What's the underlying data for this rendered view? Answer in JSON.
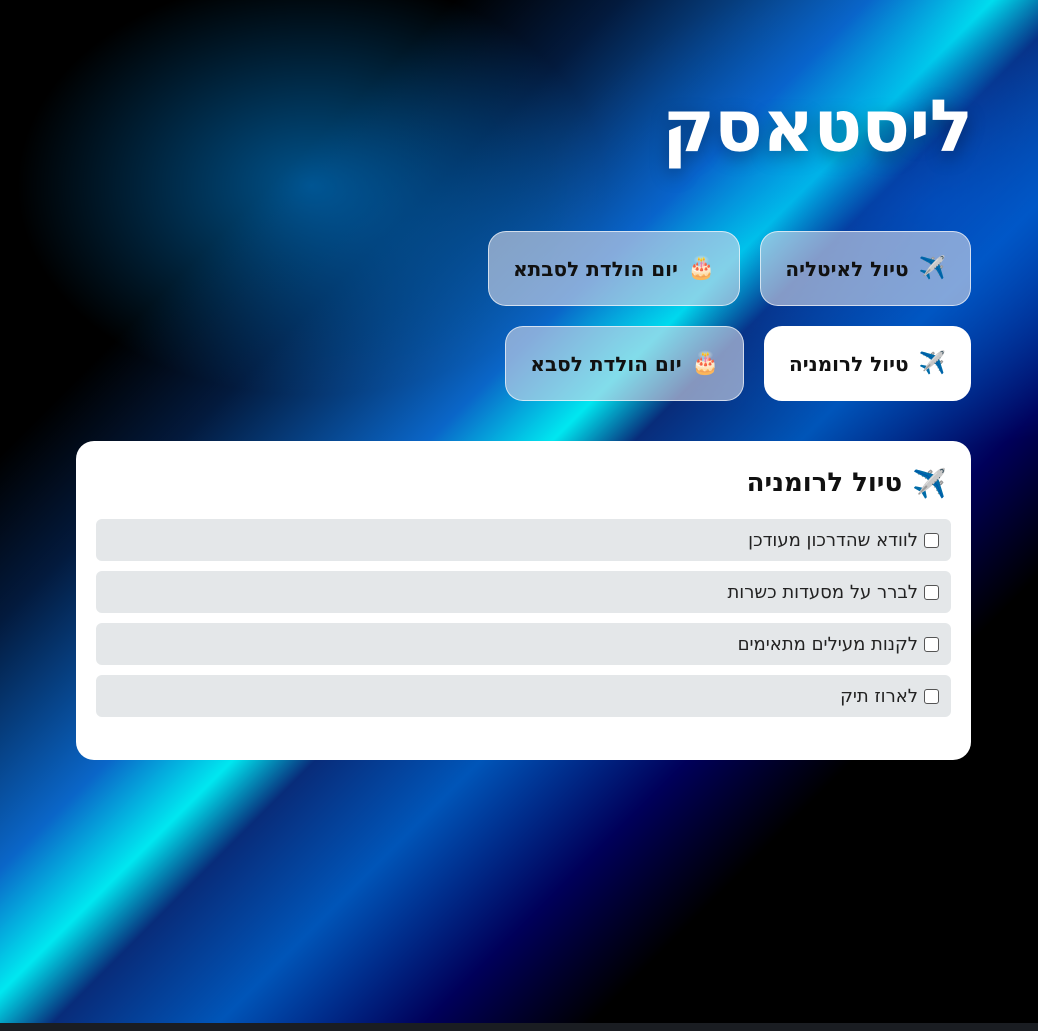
{
  "app": {
    "title": "ליסטאסק"
  },
  "tabs": [
    {
      "icon": "airplane-icon",
      "emoji": "✈️",
      "label": "טיול לאיטליה",
      "active": false
    },
    {
      "icon": "birthday-cake-icon",
      "emoji": "🎂",
      "label": "יום הולדת לסבתא",
      "active": false
    },
    {
      "icon": "airplane-icon",
      "emoji": "✈️",
      "label": "טיול לרומניה",
      "active": true
    },
    {
      "icon": "birthday-cake-icon",
      "emoji": "🎂",
      "label": "יום הולדת לסבא",
      "active": false
    }
  ],
  "list": {
    "icon": "airplane-icon",
    "emoji": "✈️",
    "title": "טיול לרומניה",
    "items": [
      {
        "text": "לוודא שהדרכון מעודכן",
        "checked": false
      },
      {
        "text": "לברר על מסעדות כשרות",
        "checked": false
      },
      {
        "text": "לקנות מעילים מתאימים",
        "checked": false
      },
      {
        "text": "לארוז תיק",
        "checked": false
      }
    ]
  },
  "colors": {
    "accent_cyan": "#00e7f0",
    "accent_blue": "#0a66c8",
    "card_bg": "#ffffff",
    "item_bg": "#e4e7e9"
  }
}
